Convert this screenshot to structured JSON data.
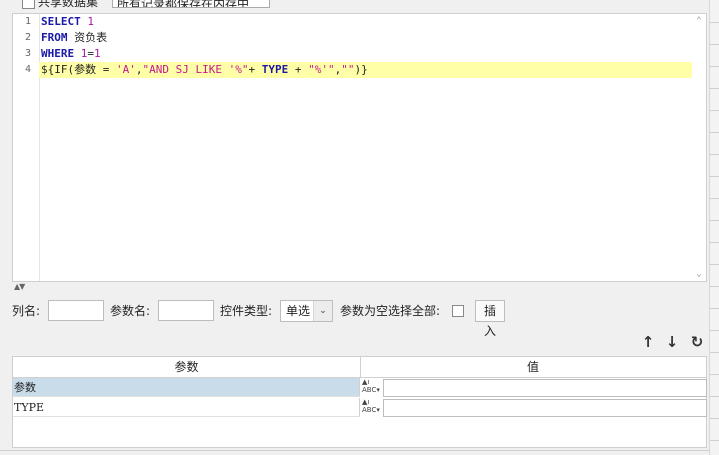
{
  "top": {
    "share_label": "共享数据集",
    "cache_select": "所有记录都保存在内存中"
  },
  "editor": {
    "line_numbers": [
      "1",
      "2",
      "3",
      "4"
    ],
    "lines": [
      [
        {
          "t": "SELECT ",
          "c": "kw"
        },
        {
          "t": "1",
          "c": "num"
        }
      ],
      [
        {
          "t": "FROM ",
          "c": "kw"
        },
        {
          "t": "资负表",
          "c": "txt"
        }
      ],
      [
        {
          "t": "WHERE ",
          "c": "kw"
        },
        {
          "t": "1",
          "c": "num"
        },
        {
          "t": "=",
          "c": "txt"
        },
        {
          "t": "1",
          "c": "num"
        }
      ],
      [
        {
          "t": "${IF(参数 = ",
          "c": "txt"
        },
        {
          "t": "'A'",
          "c": "str"
        },
        {
          "t": ",",
          "c": "txt"
        },
        {
          "t": "\"AND SJ LIKE '%\"",
          "c": "str"
        },
        {
          "t": "+ ",
          "c": "txt"
        },
        {
          "t": "TYPE",
          "c": "kw"
        },
        {
          "t": " + ",
          "c": "txt"
        },
        {
          "t": "\"%'\"",
          "c": "str"
        },
        {
          "t": ",",
          "c": "txt"
        },
        {
          "t": "\"\"",
          "c": "str"
        },
        {
          "t": ")}",
          "c": "txt"
        }
      ]
    ],
    "highlighted_line": 4
  },
  "form": {
    "column_label": "列名:",
    "param_label": "参数名:",
    "control_label": "控件类型:",
    "control_value": "单选",
    "empty_select_label": "参数为空选择全部:",
    "insert_button": "插入"
  },
  "grid": {
    "col_param": "参数",
    "col_value": "值",
    "rows": [
      {
        "param": "参数",
        "value": "",
        "selected": true
      },
      {
        "param": "TYPE",
        "value": "",
        "selected": false
      }
    ],
    "type_glyph": "ABC"
  },
  "icons": {
    "up": "up-arrow-icon",
    "down": "down-arrow-icon",
    "refresh": "refresh-icon"
  },
  "colors": {
    "keyword": "#1a1aa6",
    "number": "#a21aa6",
    "string": "#c6188f",
    "highlight_line": "#ffffa8",
    "selected_row": "#c8dcea"
  }
}
